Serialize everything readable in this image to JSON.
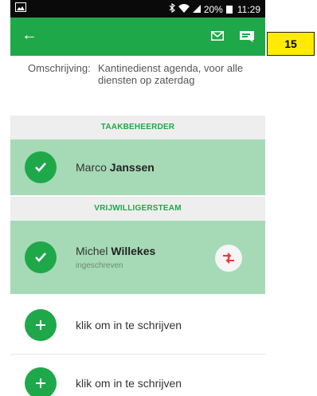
{
  "status_bar": {
    "signal_text": "20%",
    "time": "11:29"
  },
  "app_bar": {
    "back_icon": "←",
    "mail_icon": "mail-icon",
    "message_icon": "message-icon"
  },
  "description": {
    "label": "Omschrijving:",
    "value": "Kantinedienst agenda, voor alle diensten op zaterdag"
  },
  "sections": {
    "taakbeheerder": "TAAKBEHEERDER",
    "vrijwilligersteam": "VRIJWILLIGERSTEAM"
  },
  "taakbeheerder_row": {
    "first_name": "Marco",
    "last_name": "Janssen"
  },
  "volunteer_row": {
    "first_name": "Michel",
    "last_name": "Willekes",
    "status": "ingeschreven"
  },
  "signup_rows": [
    {
      "label": "klik om in te schrijven"
    },
    {
      "label": "klik om in te schrijven"
    }
  ],
  "step_badge": "15",
  "colors": {
    "brand_green": "#1fa84a",
    "assigned_row": "#a6dab7",
    "badge_yellow": "#ffea00",
    "swap_red": "#e53935"
  }
}
